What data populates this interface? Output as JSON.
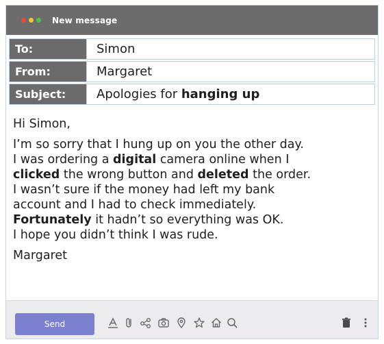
{
  "window": {
    "title": "New message",
    "colors": {
      "close": "#e84a3c",
      "minimize": "#f3c531",
      "maximize": "#4cc24b"
    }
  },
  "header": {
    "to": {
      "label": "To:",
      "value": "Simon"
    },
    "from": {
      "label": "From:",
      "value": "Margaret"
    },
    "subject": {
      "label": "Subject:",
      "value_plain": "Apologies for ",
      "value_bold": "hanging up"
    }
  },
  "body": {
    "greeting": "Hi Simon,",
    "lines": [
      [
        {
          "t": "I’m so sorry that I hung up on you the other day."
        }
      ],
      [
        {
          "t": "I was ordering a "
        },
        {
          "t": "digital",
          "b": true
        },
        {
          "t": " camera online when I"
        }
      ],
      [
        {
          "t": "clicked",
          "b": true
        },
        {
          "t": " the wrong button and "
        },
        {
          "t": "deleted",
          "b": true
        },
        {
          "t": " the order."
        }
      ],
      [
        {
          "t": "I wasn’t sure if the money had left my bank"
        }
      ],
      [
        {
          "t": "account and I had to check immediately."
        }
      ],
      [
        {
          "t": "Fortunately",
          "b": true
        },
        {
          "t": " it hadn’t so everything was OK."
        }
      ],
      [
        {
          "t": "I hope you didn’t think I was rude."
        }
      ]
    ],
    "signature": "Margaret"
  },
  "footer": {
    "send_label": "Send",
    "accent": "#7b80cf",
    "tools": [
      "format-text-icon",
      "attach-icon",
      "share-icon",
      "camera-icon",
      "location-icon",
      "star-icon",
      "home-icon",
      "search-icon",
      "trash-icon",
      "more-vertical-icon"
    ]
  }
}
